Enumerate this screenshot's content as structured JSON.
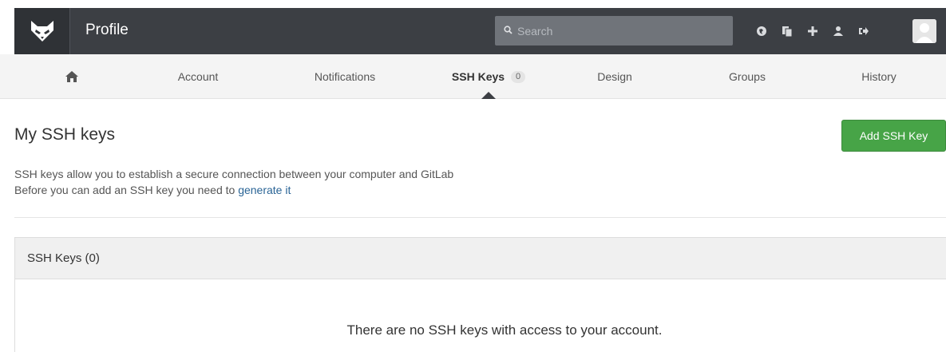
{
  "header": {
    "title": "Profile",
    "search_placeholder": "Search",
    "icons": [
      "globe-icon",
      "copy-icon",
      "plus-icon",
      "user-icon",
      "sign-out-icon"
    ]
  },
  "tabs": [
    {
      "label": "",
      "icon": "home-icon"
    },
    {
      "label": "Account"
    },
    {
      "label": "Notifications"
    },
    {
      "label": "SSH Keys",
      "badge": "0",
      "active": true
    },
    {
      "label": "Design"
    },
    {
      "label": "Groups"
    },
    {
      "label": "History"
    }
  ],
  "main": {
    "title": "My SSH keys",
    "add_button": "Add SSH Key",
    "description_line1": "SSH keys allow you to establish a secure connection between your computer and GitLab",
    "description_line2": "Before you can add an SSH key you need to",
    "generate_link": "generate it",
    "panel_title": "SSH Keys (0)",
    "empty_message": "There are no SSH keys with access to your account."
  },
  "colors": {
    "navbar": "#3c3f44",
    "button_green": "#47a447",
    "link": "#2a6496"
  }
}
